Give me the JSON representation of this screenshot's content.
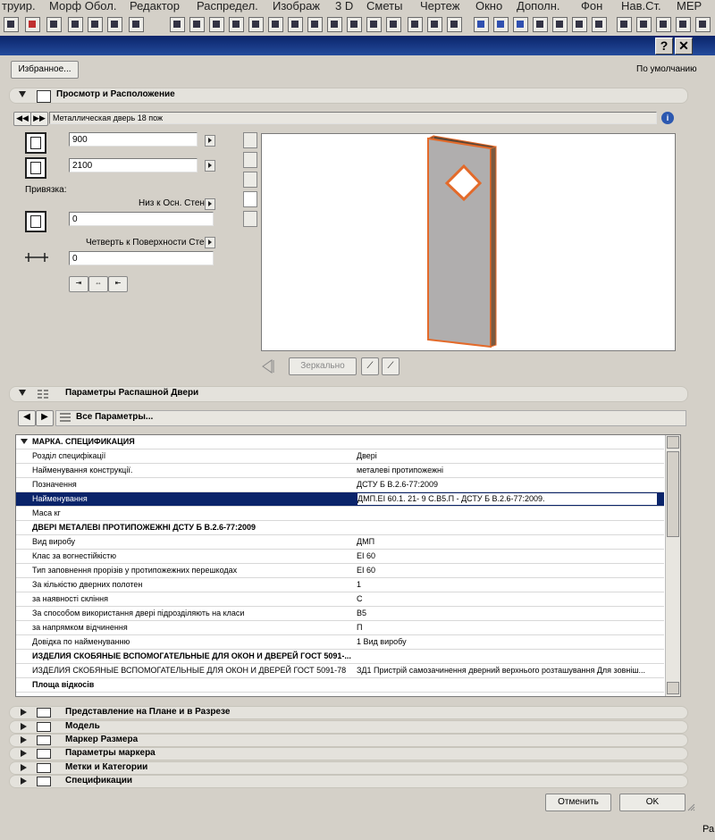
{
  "menubar": [
    "труир.",
    "Морф Обол.",
    "Редактор",
    "Распредел.",
    "Изображ",
    "3 D",
    "Сметы",
    "Чертеж",
    "Окно",
    "Дополн.",
    "Фон",
    "Нав.Ст.",
    "МЕР"
  ],
  "titlebar": {
    "help": "?",
    "close": "✕"
  },
  "favorites_label": "Избранное...",
  "default_label": "По умолчанию",
  "sections": {
    "view": "Просмотр и Расположение",
    "door_params": "Параметры Распашной Двери",
    "plan": "Представление на Плане и в Разрезе",
    "model": "Модель",
    "dim_marker": "Маркер Размера",
    "marker_params": "Параметры маркера",
    "tags": "Метки и Категории",
    "specs": "Спецификации"
  },
  "object_name": "Металлическая дверь 18 пож",
  "width_value": "900",
  "height_value": "2100",
  "anchor_label": "Привязка:",
  "anchor_base": "Низ к Осн. Стены",
  "sill_value": "0",
  "reveal_label": "Четверть к Поверхности Стены",
  "reveal_value": "0",
  "mirror_label": "Зеркально",
  "all_params_label": "Все Параметры...",
  "table": {
    "header": "МАРКА. СПЕЦИФИКАЦИЯ",
    "rows": [
      {
        "name": "Розділ специфікації",
        "value": "Двері",
        "bold": false,
        "sel": false
      },
      {
        "name": "Найменування конструкції.",
        "value": "металеві протипожежні",
        "bold": false,
        "sel": false
      },
      {
        "name": "Позначення",
        "value": "ДСТУ Б В.2.6-77:2009",
        "bold": false,
        "sel": false
      },
      {
        "name": "Найменування",
        "value": "ДМП.ЕІ 60.1. 21- 9 С.В5.П - ДСТУ Б В.2.6-77:2009.",
        "bold": false,
        "sel": true
      },
      {
        "name": "Маса кг",
        "value": "",
        "bold": false,
        "sel": false
      },
      {
        "name": "ДВЕРІ МЕТАЛЕВІ ПРОТИПОЖЕЖНІ   ДСТУ Б В.2.6-77:2009",
        "value": "",
        "bold": true,
        "sel": false
      },
      {
        "name": "Вид виробу",
        "value": "ДМП",
        "bold": false,
        "sel": false
      },
      {
        "name": "Клас за вогнестійкістю",
        "value": "ЕІ 60",
        "bold": false,
        "sel": false
      },
      {
        "name": "Тип заповнення прорізів у протипожежних перешкодах",
        "value": "ЕІ 60",
        "bold": false,
        "sel": false
      },
      {
        "name": "За кількістю дверних полотен",
        "value": "1",
        "bold": false,
        "sel": false
      },
      {
        "name": "за наявності скління",
        "value": "С",
        "bold": false,
        "sel": false
      },
      {
        "name": "За способом використання двері підрозділяють на класи",
        "value": "В5",
        "bold": false,
        "sel": false
      },
      {
        "name": "за напрямком відчинення",
        "value": "П",
        "bold": false,
        "sel": false
      },
      {
        "name": "Довідка по найменуванню",
        "value": "1 Вид виробу",
        "bold": false,
        "sel": false
      },
      {
        "name": "ИЗДЕЛИЯ СКОБЯНЫЕ ВСПОМОГАТЕЛЬНЫЕ  ДЛЯ ОКОН И ДВЕРЕЙ  ГОСТ 5091-...",
        "value": "",
        "bold": true,
        "sel": false
      },
      {
        "name": "ИЗДЕЛИЯ СКОБЯНЫЕ ВСПОМОГАТЕЛЬНЫЕ  ДЛЯ ОКОН И ДВЕРЕЙ  ГОСТ 5091-78",
        "value": "ЗД1 Пристрій самозачинення дверний верхнього розташування Для зовніш...",
        "bold": false,
        "sel": false
      },
      {
        "name": "Площа відкосів",
        "value": "",
        "bold": true,
        "sel": false
      }
    ]
  },
  "buttons": {
    "cancel": "Отменить",
    "ok": "OK"
  },
  "status_text": "Ра"
}
